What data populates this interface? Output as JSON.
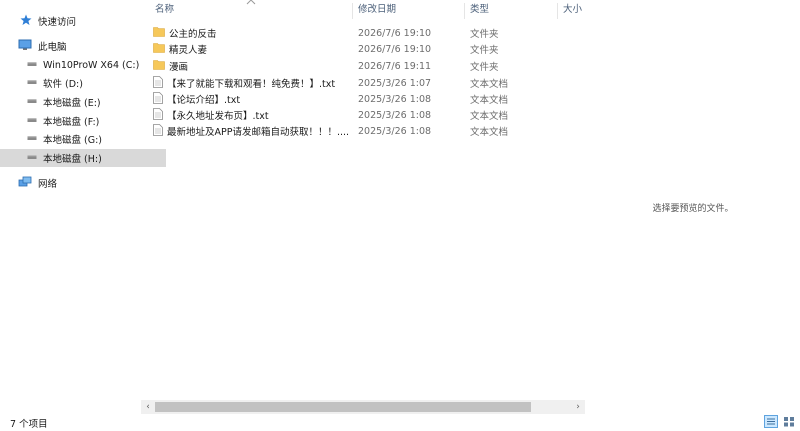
{
  "nav": {
    "quick_access": "快速访问",
    "this_pc": "此电脑",
    "drives": [
      {
        "label": "Win10ProW X64 (C:)",
        "selected": false
      },
      {
        "label": "软件 (D:)",
        "selected": false
      },
      {
        "label": "本地磁盘 (E:)",
        "selected": false
      },
      {
        "label": "本地磁盘 (F:)",
        "selected": false
      },
      {
        "label": "本地磁盘 (G:)",
        "selected": false
      },
      {
        "label": "本地磁盘 (H:)",
        "selected": true
      }
    ],
    "network": "网络"
  },
  "columns": {
    "name": "名称",
    "date": "修改日期",
    "type": "类型",
    "size": "大小"
  },
  "files": [
    {
      "name": "公主的反击",
      "date": "2026/7/6 19:10",
      "type": "文件夹",
      "icon": "folder-icon"
    },
    {
      "name": "精灵人妻",
      "date": "2026/7/6 19:10",
      "type": "文件夹",
      "icon": "folder-icon"
    },
    {
      "name": "漫画",
      "date": "2026/7/6 19:11",
      "type": "文件夹",
      "icon": "folder-icon"
    },
    {
      "name": "【来了就能下载和观看！纯免费！】.txt",
      "date": "2025/3/26 1:07",
      "type": "文本文档",
      "icon": "text-file-icon"
    },
    {
      "name": "【论坛介绍】.txt",
      "date": "2025/3/26 1:08",
      "type": "文本文档",
      "icon": "text-file-icon"
    },
    {
      "name": "【永久地址发布页】.txt",
      "date": "2025/3/26 1:08",
      "type": "文本文档",
      "icon": "text-file-icon"
    },
    {
      "name": "最新地址及APP请发邮箱自动获取！！！....",
      "date": "2025/3/26 1:08",
      "type": "文本文档",
      "icon": "text-file-icon"
    }
  ],
  "preview": {
    "message": "选择要预览的文件。"
  },
  "status": {
    "item_count": "7 个项目"
  },
  "colors": {
    "selected_bg": "#d9d9d9",
    "folder": "#f6c85a",
    "header_text": "#4c607a",
    "meta_text": "#6d6d6d"
  }
}
